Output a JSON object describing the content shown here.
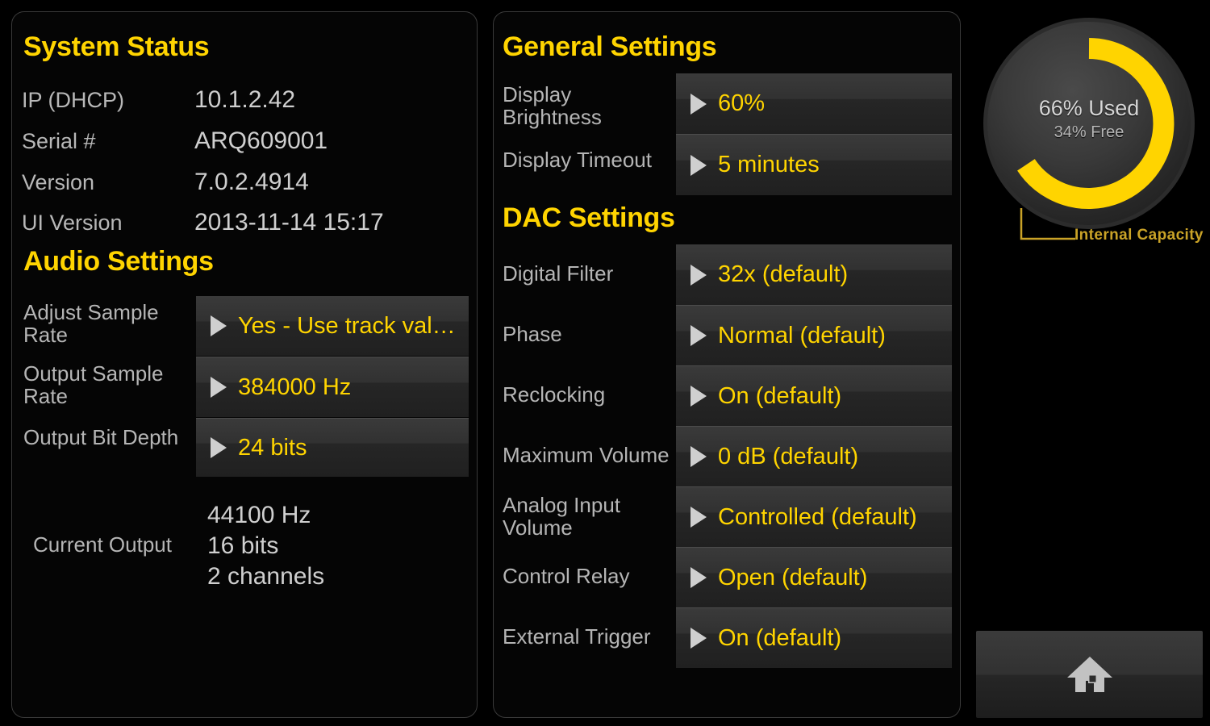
{
  "colors": {
    "accent": "#ffd400",
    "label": "#b5b5b5",
    "value": "#cfcfcf",
    "panel_border": "#3a3a3a",
    "background": "#000000",
    "caption": "#c9a227"
  },
  "panels": {
    "system_status": {
      "header": "System Status",
      "rows": [
        {
          "label": "IP (DHCP)",
          "value": "10.1.2.42"
        },
        {
          "label": "Serial #",
          "value": "ARQ609001"
        },
        {
          "label": "Version",
          "value": "7.0.2.4914"
        },
        {
          "label": "UI Version",
          "value": "2013-11-14 15:17"
        }
      ]
    },
    "audio_settings": {
      "header": "Audio Settings",
      "rows": [
        {
          "label": "Adjust Sample\nRate",
          "value": "Yes - Use track val…"
        },
        {
          "label": "Output Sample\nRate",
          "value": "384000 Hz"
        },
        {
          "label": "Output Bit Depth",
          "value": "24 bits"
        }
      ],
      "current_output": {
        "label": "Current Output",
        "value": "44100 Hz\n16 bits\n2 channels"
      }
    },
    "general_settings": {
      "header": "General Settings",
      "rows": [
        {
          "label": "Display\nBrightness",
          "value": "60%"
        },
        {
          "label": "Display Timeout",
          "value": "5 minutes"
        }
      ]
    },
    "dac_settings": {
      "header": "DAC Settings",
      "rows": [
        {
          "label": "Digital Filter",
          "value": "32x (default)"
        },
        {
          "label": "Phase",
          "value": "Normal (default)"
        },
        {
          "label": "Reclocking",
          "value": "On (default)"
        },
        {
          "label": "Maximum Volume",
          "value": "0 dB (default)"
        },
        {
          "label": "Analog Input\nVolume",
          "value": "Controlled (default)"
        },
        {
          "label": "Control Relay",
          "value": "Open (default)"
        },
        {
          "label": "External Trigger",
          "value": "On (default)"
        }
      ]
    }
  },
  "capacity": {
    "used_label": "66% Used",
    "free_label": "34% Free",
    "caption": "Internal Capacity"
  },
  "chart_data": {
    "type": "pie",
    "title": "Internal Capacity",
    "categories": [
      "Used",
      "Free"
    ],
    "values": [
      66,
      34
    ],
    "units": "%",
    "labels": [
      "66% Used",
      "34% Free"
    ],
    "colors": [
      "#ffd400",
      "#333333"
    ],
    "style": "donut",
    "start_angle_deg": 0,
    "direction": "clockwise",
    "legend": "center-label"
  },
  "home_button": {
    "icon": "home-icon",
    "label": ""
  }
}
